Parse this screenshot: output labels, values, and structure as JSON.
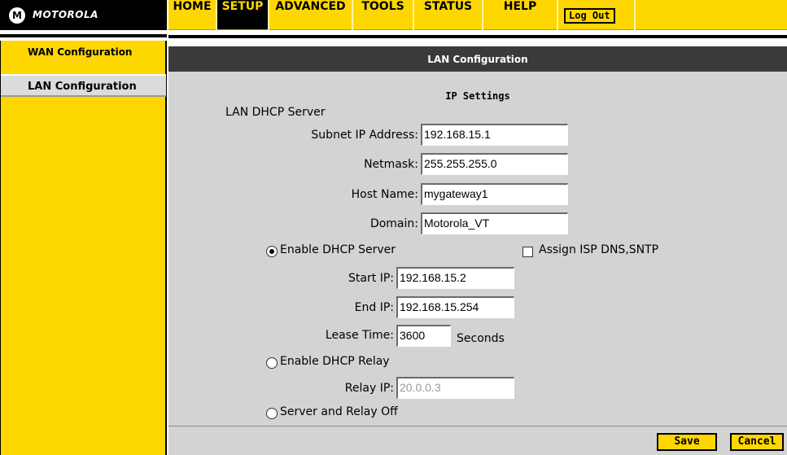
{
  "brand": {
    "logo_glyph": "M",
    "name": "MOTOROLA"
  },
  "nav": {
    "home": "HOME",
    "setup": "SETUP",
    "advanced": "ADVANCED",
    "tools": "TOOLS",
    "status": "STATUS",
    "help": "HELP",
    "logout": "Log Out"
  },
  "sidebar": {
    "items": [
      {
        "label": "WAN Configuration"
      },
      {
        "label": "LAN Configuration"
      }
    ]
  },
  "panel": {
    "title": "LAN Configuration",
    "section_title": "IP Settings",
    "group_label": "LAN DHCP Server"
  },
  "form": {
    "subnet_ip": {
      "label": "Subnet IP Address:",
      "value": "192.168.15.1"
    },
    "netmask": {
      "label": "Netmask:",
      "value": "255.255.255.0"
    },
    "host_name": {
      "label": "Host Name:",
      "value": "mygateway1"
    },
    "domain": {
      "label": "Domain:",
      "value": "Motorola_VT"
    },
    "enable_dhcp_server": {
      "label": "Enable DHCP Server",
      "selected": true
    },
    "assign_isp_dns": {
      "label": "Assign ISP DNS,SNTP",
      "checked": false
    },
    "start_ip": {
      "label": "Start IP:",
      "value": "192.168.15.2"
    },
    "end_ip": {
      "label": "End IP:",
      "value": "192.168.15.254"
    },
    "lease_time": {
      "label": "Lease Time:",
      "value": "3600",
      "unit": "Seconds"
    },
    "enable_dhcp_relay": {
      "label": "Enable DHCP Relay",
      "selected": false
    },
    "relay_ip": {
      "label": "Relay IP:",
      "value": "20.0.0.3"
    },
    "server_relay_off": {
      "label": "Server and Relay Off",
      "selected": false
    }
  },
  "buttons": {
    "save": "Save",
    "cancel": "Cancel"
  },
  "colors": {
    "accent": "#ffd700",
    "header_dark": "#000000",
    "panel_bg": "#d3d3d3",
    "title_bar": "#3a3a3a"
  }
}
